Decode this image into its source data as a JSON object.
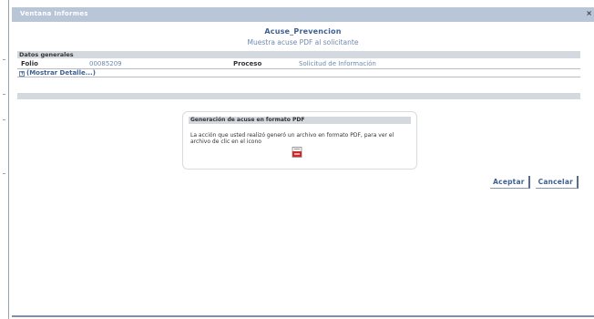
{
  "window": {
    "title": "Ventana Informes",
    "close_glyph": "×"
  },
  "heading": {
    "title": "Acuse_Prevencion",
    "subtitle": "Muestra acuse PDF al solicitante"
  },
  "general_data": {
    "section_title": "Datos generales",
    "folio_label": "Folio",
    "folio_value": "00085209",
    "process_label": "Proceso",
    "process_value": "Solicitud de Información",
    "detail_toggle": "(Mostrar Detalle...)",
    "detail_toggle_icon": "plus-icon",
    "detail_toggle_glyph": "+"
  },
  "pdf_panel": {
    "title": "Generación de acuse en formato PDF",
    "message": "La acción que usted realizó generó un archivo en formato PDF, para ver el archivo de clic en el icono",
    "icon": "pdf-icon"
  },
  "buttons": {
    "accept": "Aceptar",
    "cancel": "Cancelar"
  },
  "colors": {
    "titlebar": "#b9c6d8",
    "accent": "#3e5f93",
    "section": "#d4d9df",
    "pdf_red": "#cc2a2a"
  }
}
